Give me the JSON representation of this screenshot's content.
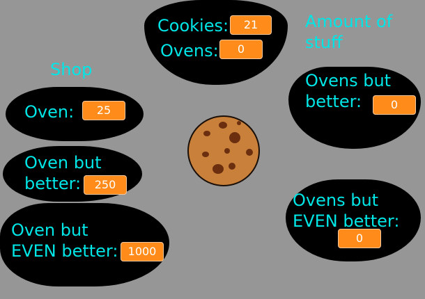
{
  "labels": {
    "shop": "Shop",
    "amount": "Amount of\nstuff"
  },
  "stats": {
    "cookies_label": "Cookies:",
    "cookies_value": "21",
    "ovens_label": "Ovens:",
    "ovens_value": "0",
    "ovens_better_label": "Ovens but\nbetter:",
    "ovens_better_value": "0",
    "ovens_even_better_label": "Ovens but\nEVEN better:",
    "ovens_even_better_value": "0"
  },
  "shop": {
    "oven_label": "Oven:",
    "oven_price": "25",
    "oven_better_label": "Oven but\nbetter:",
    "oven_better_price": "250",
    "oven_even_better_label": "Oven but\nEVEN better:",
    "oven_even_better_price": "1000"
  },
  "colors": {
    "background": "#969696",
    "panel": "#000000",
    "text": "#00e5e5",
    "value_box": "#ff8c1a",
    "cookie": "#c8803a",
    "cookie_chip": "#6b2e0f"
  },
  "icons": {
    "cookie": "cookie-icon"
  }
}
